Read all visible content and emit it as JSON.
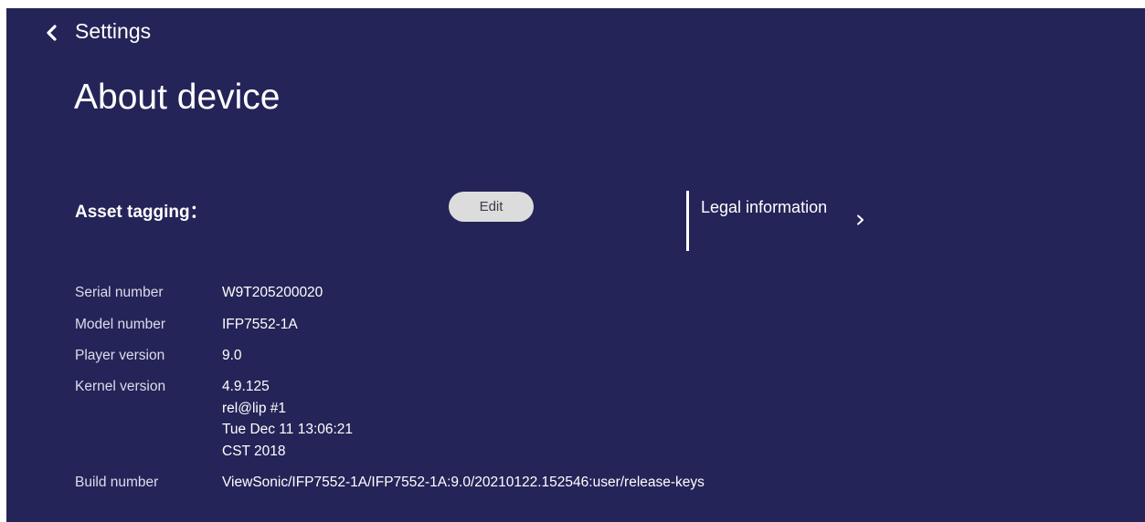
{
  "header": {
    "back_icon": "chevron-left-icon",
    "settings_label": "Settings"
  },
  "page": {
    "title": "About device"
  },
  "asset_tagging": {
    "label": "Asset tagging：",
    "edit_label": "Edit"
  },
  "legal": {
    "label": "Legal information",
    "chevron_icon": "chevron-right-icon"
  },
  "device_info": {
    "serial_number": {
      "label": "Serial number",
      "value": "W9T205200020"
    },
    "model_number": {
      "label": "Model number",
      "value": "IFP7552-1A"
    },
    "player_version": {
      "label": "Player version",
      "value": "9.0"
    },
    "kernel_version": {
      "label": "Kernel version",
      "lines": [
        "4.9.125",
        "rel@lip #1",
        "Tue Dec 11 13:06:21",
        "CST 2018"
      ]
    },
    "build_number": {
      "label": "Build number",
      "value": "ViewSonic/IFP7552-1A/IFP7552-1A:9.0/20210122.152546:user/release-keys"
    }
  },
  "colors": {
    "background": "#252458",
    "text": "#ffffff",
    "button_bg": "#dcdcdc",
    "button_text": "#3d3d4a"
  }
}
